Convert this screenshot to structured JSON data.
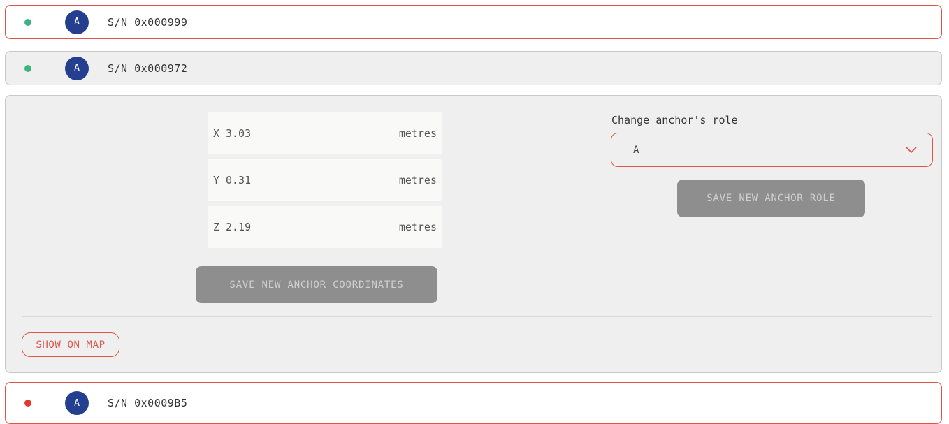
{
  "anchors": [
    {
      "status_color": "#3bb482",
      "role": "A",
      "serial": "S/N 0x000999"
    },
    {
      "status_color": "#3bb482",
      "role": "A",
      "serial": "S/N 0x000972"
    },
    {
      "status_color": "#e03a2e",
      "role": "A",
      "serial": "S/N 0x0009B5"
    }
  ],
  "details": {
    "coordinates": [
      {
        "axis": "X",
        "value": "3.03",
        "unit": "metres"
      },
      {
        "axis": "Y",
        "value": "0.31",
        "unit": "metres"
      },
      {
        "axis": "Z",
        "value": "2.19",
        "unit": "metres"
      }
    ],
    "save_coordinates_label": "SAVE NEW ANCHOR COORDINATES",
    "role_label": "Change anchor's role",
    "role_selected": "A",
    "save_role_label": "SAVE NEW ANCHOR ROLE",
    "show_on_map_label": "SHOW ON MAP"
  },
  "colors": {
    "accent": "#e1544a",
    "avatar": "#243f8f",
    "online": "#3bb482",
    "offline": "#e03a2e",
    "disabled_button": "#8e8e8e"
  }
}
